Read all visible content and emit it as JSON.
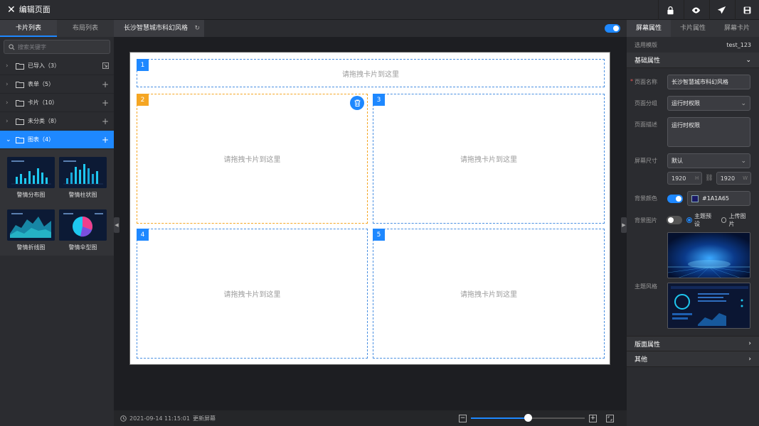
{
  "topbar": {
    "close_icon": "close-icon",
    "title": "编辑页面",
    "actions": [
      "lock-icon",
      "eye-icon",
      "send-icon",
      "save-icon"
    ]
  },
  "left": {
    "tabs": [
      {
        "label": "卡片列表",
        "active": true
      },
      {
        "label": "布局列表",
        "active": false
      }
    ],
    "search_placeholder": "搜索关键字",
    "tree": [
      {
        "label": "已导入（3）",
        "action": "import-icon"
      },
      {
        "label": "表单（5）",
        "action": "plus-icon"
      },
      {
        "label": "卡片（10）",
        "action": "plus-icon"
      },
      {
        "label": "未分类（8）",
        "action": "plus-icon"
      },
      {
        "label": "图表（4）",
        "action": "plus-icon",
        "active": true
      }
    ],
    "cards": [
      {
        "label": "警情分布图"
      },
      {
        "label": "警情柱状图"
      },
      {
        "label": "警情折线图"
      },
      {
        "label": "警情伞型图"
      }
    ]
  },
  "center": {
    "tab_label": "长沙智慧城市科幻风格",
    "toggle_on": true,
    "slots": [
      {
        "num": "1",
        "text": "请拖拽卡片到这里"
      },
      {
        "num": "2",
        "text": "请拖拽卡片到这里",
        "selected": true
      },
      {
        "num": "3",
        "text": "请拖拽卡片到这里"
      },
      {
        "num": "4",
        "text": "请拖拽卡片到这里"
      },
      {
        "num": "5",
        "text": "请拖拽卡片到这里"
      }
    ],
    "status": {
      "timestamp": "2021-09-14 11:15:01",
      "update_label": "更新屏幕",
      "zoom_fraction": 0.5
    }
  },
  "right": {
    "tabs": [
      {
        "label": "屏幕属性",
        "active": true
      },
      {
        "label": "卡片属性",
        "active": false
      },
      {
        "label": "屏幕卡片",
        "active": false
      }
    ],
    "template_label": "选用模版",
    "template_value": "test_123",
    "basic_section": "基础属性",
    "page_name_label": "页面名称",
    "page_name_value": "长沙智慧城市科幻风格",
    "page_group_label": "页面分组",
    "page_group_value": "运行时权限",
    "page_desc_label": "页面描述",
    "page_desc_value": "运行时权限",
    "screen_size_label": "屏幕尺寸",
    "screen_size_value": "默认",
    "height_value": "1920",
    "height_unit": "H",
    "width_value": "1920",
    "width_unit": "W",
    "bg_color_label": "背景颜色",
    "bg_color_value": "#1A1A65",
    "bg_color_swatch": "#1a1a65",
    "bg_image_label": "背景图片",
    "bg_image_options": [
      "主题预设",
      "上传图片"
    ],
    "theme_label": "主题风格",
    "layout_section": "版面属性",
    "other_section": "其他"
  }
}
